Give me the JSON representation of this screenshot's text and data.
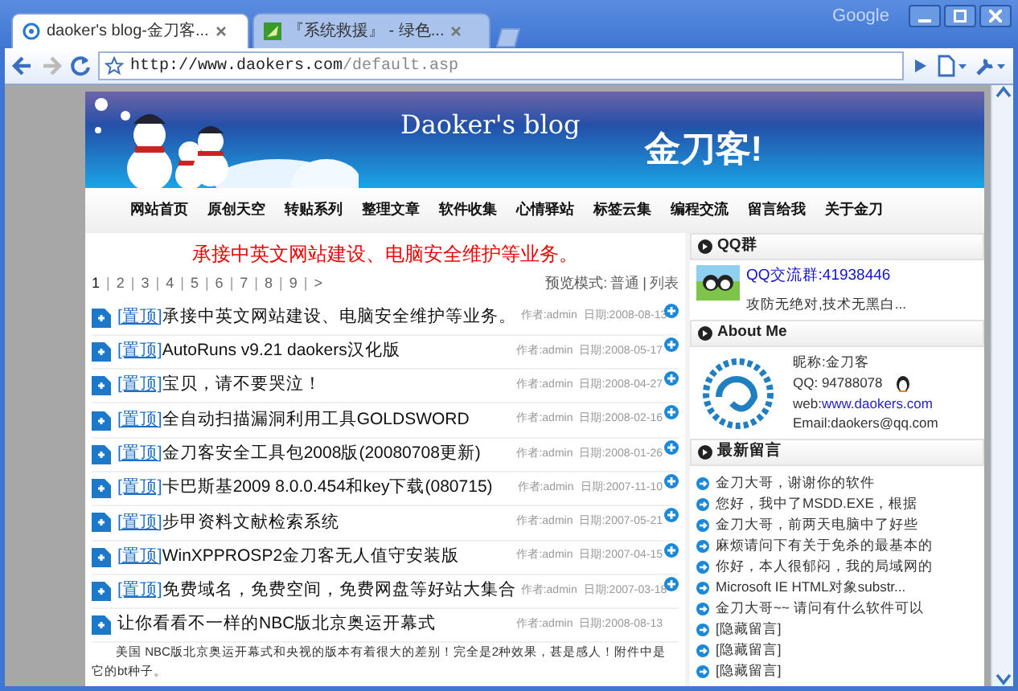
{
  "browser": {
    "brand": "Google",
    "tabs": [
      {
        "title": "daoker's blog-金刀客...",
        "selected": true
      },
      {
        "title": "『系统救援』 - 绿色...",
        "selected": false
      }
    ],
    "address": {
      "host": "http://www.daokers.com",
      "path": "/default.asp"
    },
    "back_disabled": false,
    "forward_disabled": true
  },
  "banner": {
    "title": "Daoker's blog",
    "subtitle": "金刀客!"
  },
  "nav": [
    "网站首页",
    "原创天空",
    "转贴系列",
    "整理文章",
    "软件收集",
    "心情驿站",
    "标签云集",
    "编程交流",
    "留言给我",
    "关于金刀"
  ],
  "notice": "承接中英文网站建设、电脑安全维护等业务。",
  "pagination": {
    "separator": "|",
    "pages": [
      {
        "label": "1",
        "selected": true
      },
      {
        "label": "2",
        "selected": false
      },
      {
        "label": "3",
        "selected": false
      },
      {
        "label": "4",
        "selected": false
      },
      {
        "label": "5",
        "selected": false
      },
      {
        "label": "6",
        "selected": false
      },
      {
        "label": "7",
        "selected": false
      },
      {
        "label": "8",
        "selected": false
      },
      {
        "label": "9",
        "selected": false
      },
      {
        "label": ">",
        "selected": false
      }
    ]
  },
  "view_mode": {
    "label": "预览模式:",
    "separator": "|",
    "options": [
      "普通",
      "列表"
    ]
  },
  "posts": [
    {
      "tag": "[置顶]",
      "title": "承接中英文网站建设、电脑安全维护等业务。",
      "author": "作者:admin",
      "date": "日期:2008-08-13",
      "pinned": true
    },
    {
      "tag": "[置顶]",
      "title": "AutoRuns v9.21 daokers汉化版",
      "author": "作者:admin",
      "date": "日期:2008-05-17",
      "pinned": true
    },
    {
      "tag": "[置顶]",
      "title": "宝贝，请不要哭泣！",
      "author": "作者:admin",
      "date": "日期:2008-04-27",
      "pinned": true
    },
    {
      "tag": "[置顶]",
      "title": "全自动扫描漏洞利用工具GOLDSWORD",
      "author": "作者:admin",
      "date": "日期:2008-02-16",
      "pinned": true
    },
    {
      "tag": "[置顶]",
      "title": "金刀客安全工具包2008版(20080708更新)",
      "author": "作者:admin",
      "date": "日期:2008-01-26",
      "pinned": true
    },
    {
      "tag": "[置顶]",
      "title": "卡巴斯基2009 8.0.0.454和key下载(080715)",
      "author": "作者:admin",
      "date": "日期:2007-11-10",
      "pinned": true
    },
    {
      "tag": "[置顶]",
      "title": "步甲资料文献检索系统",
      "author": "作者:admin",
      "date": "日期:2007-05-21",
      "pinned": true
    },
    {
      "tag": "[置顶]",
      "title": "WinXPPROSP2金刀客无人值守安装版",
      "author": "作者:admin",
      "date": "日期:2007-04-15",
      "pinned": true
    },
    {
      "tag": "[置顶]",
      "title": "免费域名，免费空间，免费网盘等好站大集合",
      "author": "作者:admin",
      "date": "日期:2007-03-18",
      "pinned": true
    },
    {
      "title": "让你看看不一样的NBC版北京奥运开幕式",
      "author": "作者:admin",
      "date": "日期:2008-08-13",
      "pinned": false,
      "excerpt": "美国 NBC版北京奥运开幕式和央视的版本有着很大的差别！完全是2种效果，甚是感人！附件中是它的bt种子。"
    }
  ],
  "sidebar": {
    "qq_group": {
      "heading": "QQ群",
      "link": "QQ交流群:41938446",
      "motto": "攻防无绝对,技术无黑白..."
    },
    "about": {
      "heading": "About Me",
      "nickname": "昵称:金刀客",
      "qq": "QQ: 94788078",
      "web_label": "web:",
      "web_link": "www.daokers.com",
      "email": "Email:daokers@qq.com"
    },
    "comments": {
      "heading": "最新留言",
      "items": [
        "金刀大哥，谢谢你的软件",
        "您好，我中了MSDD.EXE，根据",
        "金刀大哥，前两天电脑中了好些",
        "麻烦请问下有关于免杀的最基本的",
        "你好，本人很郁闷，我的局域网的",
        "Microsoft IE HTML对象substr...",
        "金刀大哥~~ 请问有什么软件可以",
        "[隐藏留言]",
        "[隐藏留言]",
        "[隐藏留言]"
      ]
    }
  }
}
